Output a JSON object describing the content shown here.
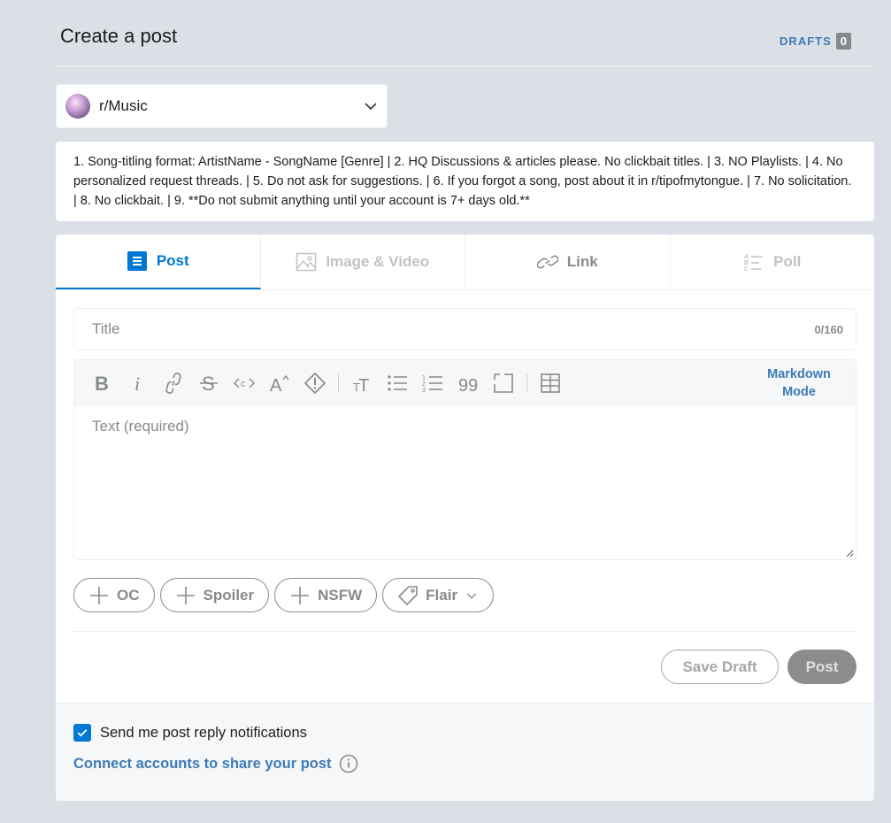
{
  "header": {
    "title": "Create a post",
    "drafts_label": "DRAFTS",
    "drafts_count": "0"
  },
  "community": {
    "name": "r/Music"
  },
  "rules": {
    "text": "1. Song-titling format: ArtistName - SongName [Genre] | 2. HQ Discussions & articles please. No clickbait titles. | 3. NO Playlists. | 4. No personalized request threads. | 5. Do not ask for suggestions. | 6. If you forgot a song, post about it in r/tipofmytongue. | 7. No solicitation. | 8. No clickbait. | 9. **Do not submit anything until your account is 7+ days old.**"
  },
  "tabs": [
    {
      "label": "Post",
      "icon": "post-icon",
      "state": "active"
    },
    {
      "label": "Image & Video",
      "icon": "image-icon",
      "state": "disabled"
    },
    {
      "label": "Link",
      "icon": "link-icon",
      "state": "normal"
    },
    {
      "label": "Poll",
      "icon": "poll-icon",
      "state": "disabled"
    }
  ],
  "title_field": {
    "placeholder": "Title",
    "counter": "0/160"
  },
  "editor": {
    "placeholder": "Text (required)",
    "markdown_mode_line1": "Markdown",
    "markdown_mode_line2": "Mode",
    "toolbar_icons": [
      "bold-icon",
      "italic-icon",
      "link-icon",
      "strikethrough-icon",
      "inline-code-icon",
      "superscript-icon",
      "spoiler-icon",
      "heading-icon",
      "bulleted-list-icon",
      "numbered-list-icon",
      "quote-block-icon",
      "code-block-icon",
      "table-icon"
    ]
  },
  "pills": [
    {
      "label": "OC",
      "icon": "plus-icon"
    },
    {
      "label": "Spoiler",
      "icon": "plus-icon"
    },
    {
      "label": "NSFW",
      "icon": "plus-icon"
    },
    {
      "label": "Flair",
      "icon": "tag-icon"
    }
  ],
  "actions": {
    "save_draft": "Save Draft",
    "post": "Post"
  },
  "footer": {
    "notify_label": "Send me post reply notifications",
    "notify_checked": true,
    "connect_label": "Connect accounts to share your post"
  },
  "colors": {
    "accent": "#0079d3",
    "link": "#3d7bb7",
    "background": "#dae0e6",
    "muted": "#878a8c"
  }
}
